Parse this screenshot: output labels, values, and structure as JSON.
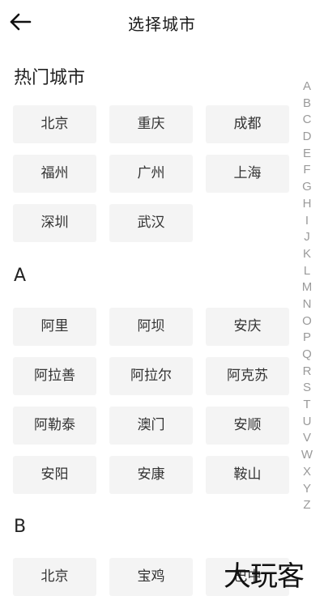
{
  "header": {
    "title": "选择城市",
    "back_icon": "arrow-left-icon"
  },
  "sections": {
    "hot": {
      "title": "热门城市",
      "cities": [
        "北京",
        "重庆",
        "成都",
        "福州",
        "广州",
        "上海",
        "深圳",
        "武汉"
      ]
    },
    "a": {
      "title": "A",
      "cities": [
        "阿里",
        "阿坝",
        "安庆",
        "阿拉善",
        "阿拉尔",
        "阿克苏",
        "阿勒泰",
        "澳门",
        "安顺",
        "安阳",
        "安康",
        "鞍山"
      ]
    },
    "b": {
      "title": "B",
      "cities": [
        "北京",
        "宝鸡",
        "巴中"
      ]
    }
  },
  "alphabet": [
    "A",
    "B",
    "C",
    "D",
    "E",
    "F",
    "G",
    "H",
    "I",
    "J",
    "K",
    "L",
    "M",
    "N",
    "O",
    "P",
    "Q",
    "R",
    "S",
    "T",
    "U",
    "V",
    "W",
    "X",
    "Y",
    "Z"
  ],
  "watermark": "大玩客",
  "colors": {
    "button_bg": "#f4f4f4",
    "index_letter": "#9a9a9a",
    "text": "#333333"
  }
}
